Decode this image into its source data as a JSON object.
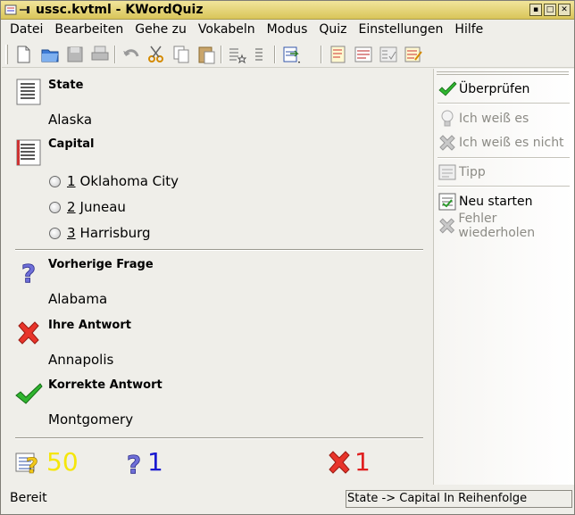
{
  "window": {
    "title": "ussc.kvtml - KWordQuiz",
    "titlebar_color": "#d9c559"
  },
  "menu": [
    "Datei",
    "Bearbeiten",
    "Gehe zu",
    "Vokabeln",
    "Modus",
    "Quiz",
    "Einstellungen",
    "Hilfe"
  ],
  "toolbar": {
    "icons": [
      "new-file-icon",
      "open-folder-icon",
      "save-icon",
      "print-icon",
      "undo-icon",
      "cut-icon",
      "copy-icon",
      "paste-icon",
      "vocabulary-icon",
      "list-icon",
      "mode-icon",
      "editor-icon",
      "flashcard-icon",
      "multiple-choice-icon",
      "question-answer-icon"
    ]
  },
  "quiz": {
    "question_label": "State",
    "question_value": "Alaska",
    "answer_label": "Capital",
    "choices": [
      {
        "num": "1",
        "text": "Oklahoma City"
      },
      {
        "num": "2",
        "text": "Juneau"
      },
      {
        "num": "3",
        "text": "Harrisburg"
      }
    ],
    "previous_label": "Vorherige Frage",
    "previous_value": "Alabama",
    "your_answer_label": "Ihre Antwort",
    "your_answer_value": "Annapolis",
    "correct_label": "Korrekte Antwort",
    "correct_value": "Montgomery"
  },
  "scores": {
    "total": "50",
    "answered": "1",
    "wrong": "1",
    "total_color": "#f5e60a",
    "answered_color": "#1a1ad0",
    "wrong_color": "#e02020"
  },
  "sidebar": {
    "check": "Überprüfen",
    "know": "Ich weiß es",
    "dont_know": "Ich weiß es nicht",
    "hint": "Tipp",
    "restart": "Neu starten",
    "repeat_errors": "Fehler wiederholen"
  },
  "status": {
    "left": "Bereit",
    "right": "State -> Capital In Reihenfolge"
  }
}
